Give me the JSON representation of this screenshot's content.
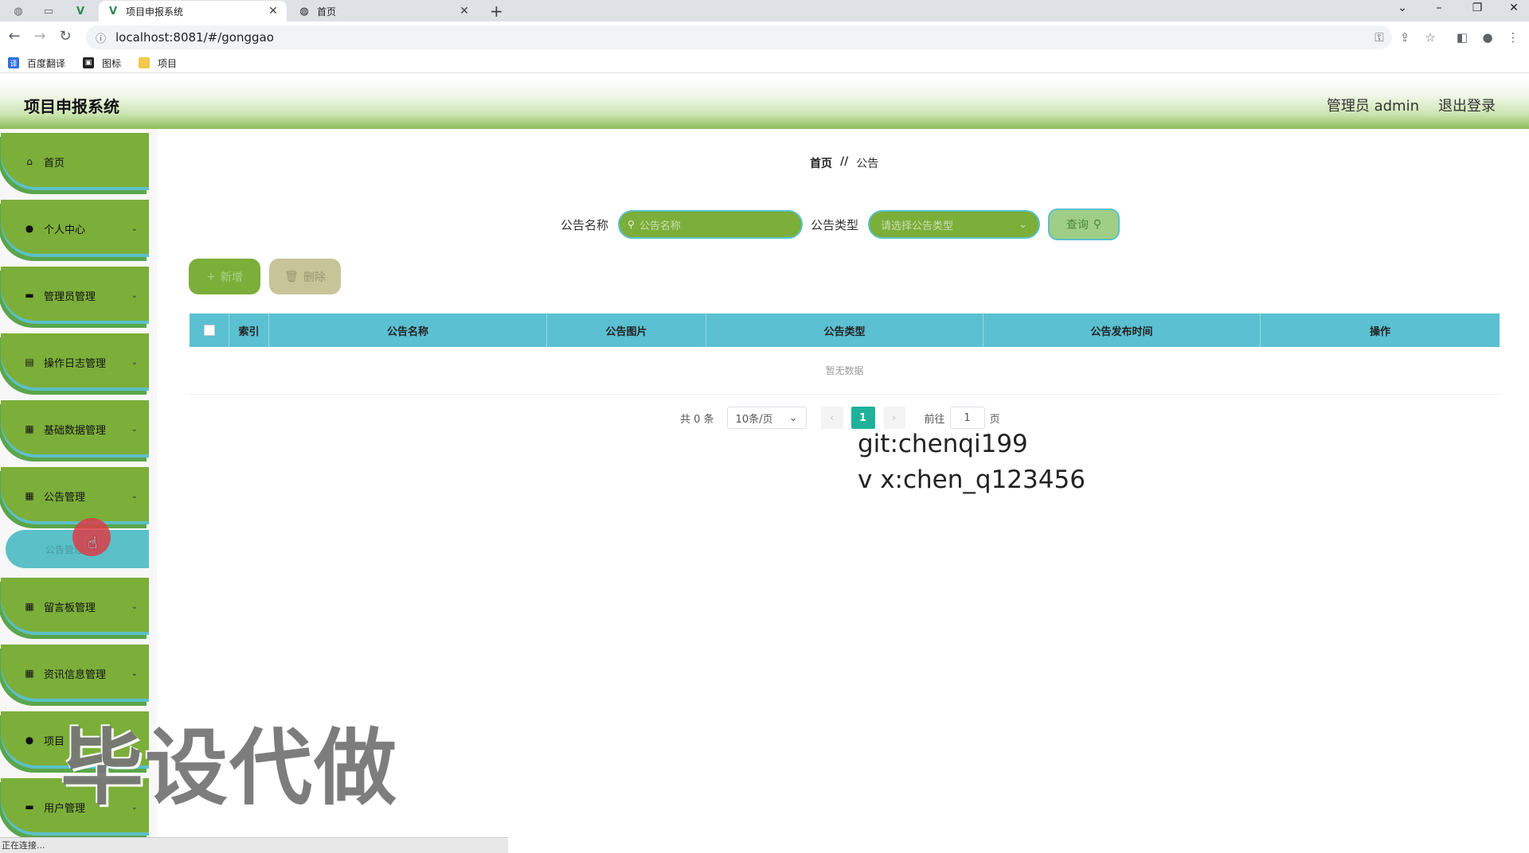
{
  "browser": {
    "tabs": [
      {
        "title": "项目申报系统",
        "active": true
      },
      {
        "title": "首页",
        "active": false
      }
    ],
    "url": "localhost:8081/#/gonggao",
    "bookmarks": [
      {
        "label": "百度翻译",
        "color": "#2f6fe0"
      },
      {
        "label": "图标",
        "color": "#222222"
      },
      {
        "label": "项目",
        "color": "#f2c94c"
      }
    ]
  },
  "header": {
    "title": "项目申报系统",
    "user_label": "管理员 admin",
    "logout_label": "退出登录"
  },
  "sidebar": {
    "items": [
      {
        "label": "首页",
        "icon": "home-icon",
        "has_children": false
      },
      {
        "label": "个人中心",
        "icon": "user-icon",
        "has_children": true
      },
      {
        "label": "管理员管理",
        "icon": "monitor-icon",
        "has_children": true
      },
      {
        "label": "操作日志管理",
        "icon": "document-icon",
        "has_children": true
      },
      {
        "label": "基础数据管理",
        "icon": "grid-icon",
        "has_children": true
      },
      {
        "label": "公告管理",
        "icon": "grid-icon",
        "has_children": true
      },
      {
        "label": "留言板管理",
        "icon": "grid-icon",
        "has_children": true
      },
      {
        "label": "资讯信息管理",
        "icon": "grid-icon",
        "has_children": true
      },
      {
        "label": "项目",
        "icon": "user-icon",
        "has_children": true
      },
      {
        "label": "用户管理",
        "icon": "monitor-icon",
        "has_children": true
      }
    ],
    "submenu_label": "公告管理"
  },
  "breadcrumb": {
    "home": "首页",
    "separator": "//",
    "current": "公告"
  },
  "search": {
    "name_label": "公告名称",
    "name_placeholder": "公告名称",
    "type_label": "公告类型",
    "type_placeholder": "请选择公告类型",
    "query_label": "查询"
  },
  "actions": {
    "add_label": "新增",
    "delete_label": "删除"
  },
  "table": {
    "columns": [
      "索引",
      "公告名称",
      "公告图片",
      "公告类型",
      "公告发布时间",
      "操作"
    ],
    "empty_text": "暂无数据"
  },
  "pagination": {
    "total_text": "共 0 条",
    "page_size": "10条/页",
    "current_page": "1",
    "goto_label": "前往",
    "goto_value": "1",
    "page_suffix": "页"
  },
  "overlay": {
    "line1": "git:chenqi199",
    "line2": "v x:chen_q123456",
    "big_watermark": "毕设代做"
  },
  "status_bar": "正在连接...",
  "colors": {
    "menu_green": "#7cae3a",
    "accent_teal": "#5bc0c8",
    "table_header": "#5bc0d2",
    "page_active": "#1fb19a"
  }
}
